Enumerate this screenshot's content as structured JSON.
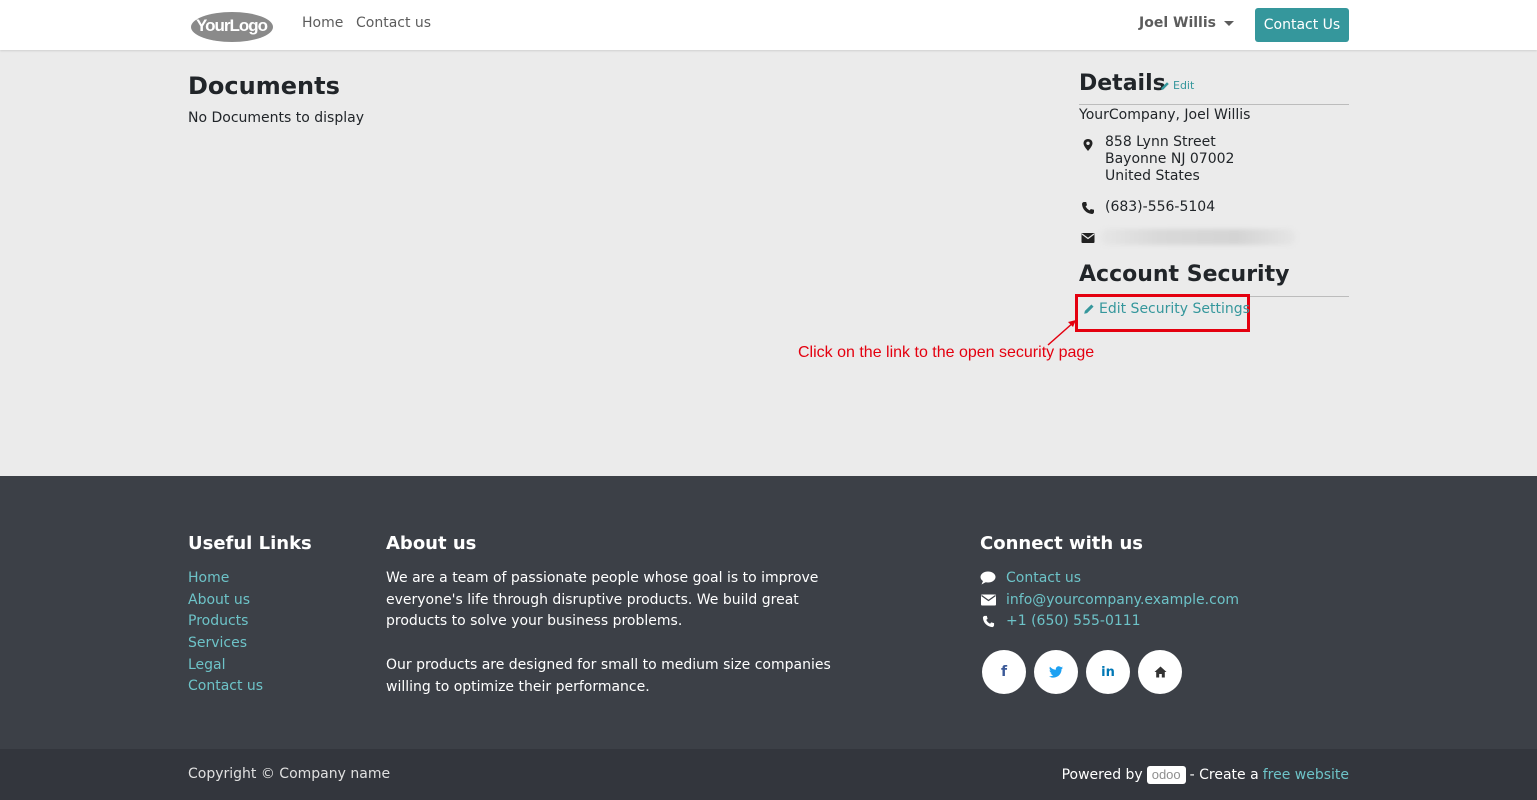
{
  "header": {
    "logo_text": "YourLogo",
    "nav": [
      {
        "label": "Home"
      },
      {
        "label": "Contact us"
      }
    ],
    "user_name": "Joel Willis",
    "contact_button": "Contact Us"
  },
  "documents": {
    "title": "Documents",
    "empty_text": "No Documents to display"
  },
  "details": {
    "title": "Details",
    "edit_label": "Edit",
    "company_line": "YourCompany, Joel Willis",
    "address_lines": [
      "858 Lynn Street",
      "Bayonne NJ 07002",
      "United States"
    ],
    "phone": "(683)-556-5104"
  },
  "security": {
    "title": "Account Security",
    "edit_link": "Edit Security Settings",
    "annotation": "Click on the link to the open security page"
  },
  "footer": {
    "useful_links": {
      "heading": "Useful Links",
      "items": [
        {
          "label": "Home"
        },
        {
          "label": "About us"
        },
        {
          "label": "Products"
        },
        {
          "label": "Services"
        },
        {
          "label": "Legal"
        },
        {
          "label": "Contact us"
        }
      ]
    },
    "about": {
      "heading": "About us",
      "paragraph1": "We are a team of passionate people whose goal is to improve everyone's life through disruptive products. We build great products to solve your business problems.",
      "paragraph2": "Our products are designed for small to medium size companies willing to optimize their performance."
    },
    "connect": {
      "heading": "Connect with us",
      "items": [
        {
          "icon": "comment-icon",
          "label": "Contact us"
        },
        {
          "icon": "envelope-icon",
          "label": "info@yourcompany.example.com"
        },
        {
          "icon": "phone-icon",
          "label": "+1 (650) 555-0111"
        }
      ],
      "social": [
        {
          "icon": "facebook-icon",
          "glyph": "f",
          "color": "#3b5998"
        },
        {
          "icon": "twitter-icon",
          "glyph": "🐦",
          "color": "#1da1f2"
        },
        {
          "icon": "linkedin-icon",
          "glyph": "in",
          "color": "#0077b5"
        },
        {
          "icon": "home-icon",
          "glyph": "⌂",
          "color": "#333333"
        }
      ]
    }
  },
  "bottom": {
    "copyright": "Copyright © Company name",
    "powered_prefix": "Powered by",
    "odoo": "odoo",
    "create_text": "- Create a",
    "free_website": "free website"
  },
  "colors": {
    "accent": "#35979c",
    "link": "#6dc3c8",
    "annotation_red": "#e4000f",
    "footer_bg": "#3c4047"
  }
}
